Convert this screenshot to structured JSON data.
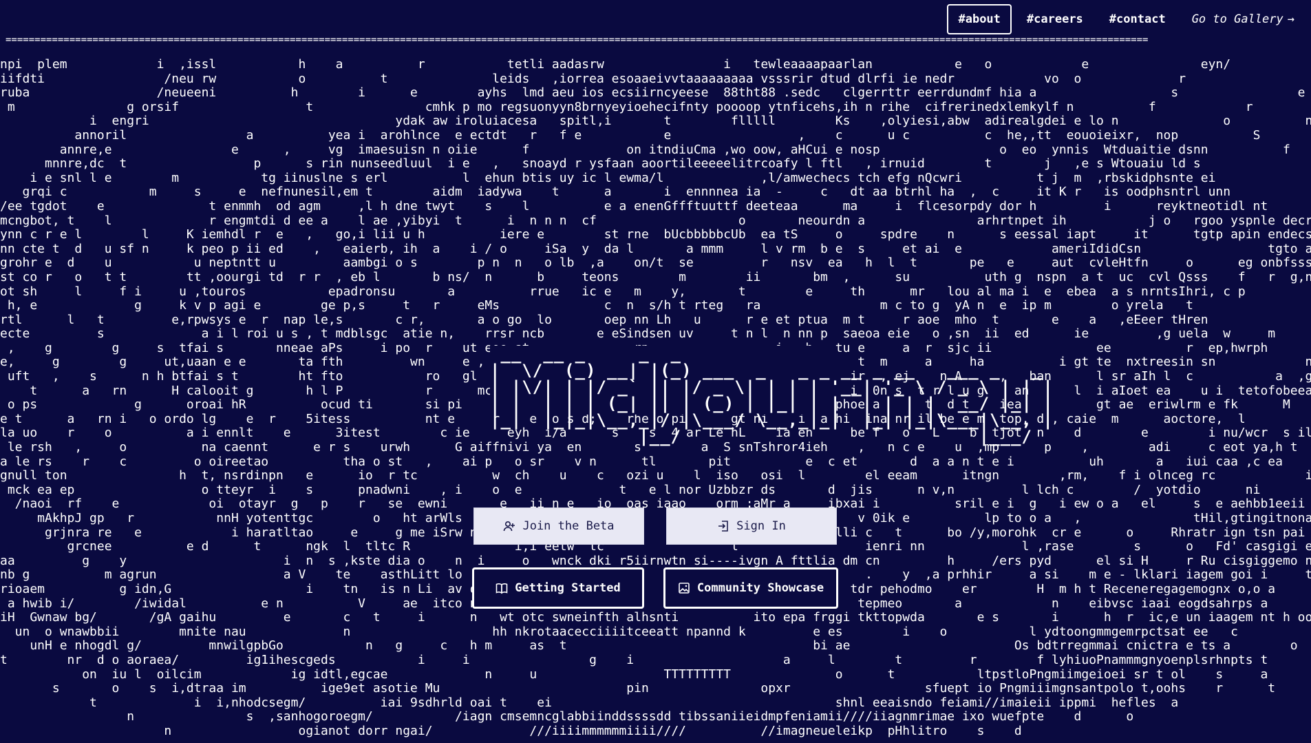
{
  "nav": {
    "about": "#about",
    "careers": "#careers",
    "contact": "#contact",
    "gallery": "Go to Gallery",
    "gallery_arrow": "→"
  },
  "divider": "=====================================================================================================================================================================================================",
  "logo_ascii": " __  __ _     _  _\n|  \\/  (_) __| |(_) ___  _   _ _ __ _ __   ___ _   _\n| |\\/| | |/ _` || |/ _ \\| | | | '__| '_ \\ / _ \\ | | |\n| |  | | | (_| || | (_) | |_| | |  | | | |  __/ |_| |\n|_|  |_|_|\\__,_|/ |\\___/ \\__,_|_|  |_| |_|\\___|\\__, |\n              |__/                            |___/",
  "logo_label": "Midjourney",
  "buttons": {
    "join_beta": "Join the Beta",
    "sign_in": "Sign In",
    "getting_started": "Getting Started",
    "community_showcase": "Community Showcase"
  },
  "background_lines": [
    "npi  plem            i  ,issl           h    a          r           tetli aadasrw                i   tewleaaaapaarlan           e   o            e               eyn/",
    "iifdti                /neu rw           o          t              leids   ,iorrea esoaaeivvtaaaaaaaaa vsssrir dtud dlrfi ie nedr            vo  o             r                    eta",
    "ruba                 /neueeni          h        i      e        ayhs  lmd aeu ios ecsiirncyeese  88tht88 .sedc   clgerrttr eerrdundmf hia a                  s                e",
    " m               g orsif                 t               cmhk p mo regsuonyyn8brnyeyioehecifnty poooop ytnficehs,ih n rihe  cifrerinedxlemkylf n          f            r",
    "            i  engri                                 ydak aw iroluiacesa   spitl,i       t        flllll        Ks    ,olyiesi,abw  adirealgdei e lo n              o          n",
    "          annoril                a          yea i  arohlnce  e ectdt   r   f e           e                 ,    c      u c          c  he,,tt  eouoieixr,  nop          S",
    "        annre,e                e      ,     vg  imaesuisn n oiie      f             on itndiuCma ,wo oow, aHCui e nosp                o  eo  ynnis  Wtduaitie dsnn          f          e l",
    "      mnnre,dc  t                 p      s rin nunseedluul  i e   ,   snoayd r ysfaan aoortileeeeelitrcoafy l ftl   , irnuid        t       j   ,e s Wtouaiu ld s",
    "    i e snl l e        m           tg iinuslne s erl          l  ehun btis uy ic l ewma/l             ,l/amwechecs tch efg nQcwri          t j  m  ,rbskidphsnte ei              a l",
    "   grqi c           m     s     e  nefnunesil,em t        aidm  iadywa    t      a       i  ennnnea ia  -     c   dt aa btrhl ha  ,  c     it K r   is oodphsntrl unn",
    "/ee tgdot    e              t enmmh  od agm     ,l h dne twyt    s    l          e a enenGffftuuttf deeteaa      ma     i  flcesorpdy dor h         i      reyktneotidl nt          o",
    "mcngbot, t    l             r engmtdi d ee a    l ae ,yibyi  t      i  n n n  cf                   o       neourdn a               arhrtnpet ih           j o   rgoo yspnle decrb       o",
    "ynn c r e l        l     K iemhdl r  e   ,   go,i lii u h          iere e        st rne  bUcbbbbbcUb  ea tS     o     spdre    n      s eessal iapt     it      tgtp apin endecst      S ,",
    "nn cte t  d   u sf n     k peo p ii ed    ,   eaierb, ih  a    i / o     iSa  y  da l       a mmm     l v rm  b e  s     et ai  e            ameriIdidCsn                 tgto asanly h ria",
    "grohr e  d    u           u neptntt u         aambgi o s        p n  n   o lb  ,a    on/t  se         r   nsv  ea   h  l  t       pe   e     aut  cvleHtfn     o      eg onbfsssrdabts      s",
    "st co r   o   t t        tt ,oourgi td  r r  , eb l       b ns/  n      b     teons        m        ii       bm  ,      su          uth g  nspn  a t  uc  cvl Qsss    f   r  g,nu a ailtph ito",
    "ot sh     l     f i     u ,touros           epadronsu       a          rrue   ic e   m    y,       t        e     th      mr   lou al ma i  e  ebea  a s nrntsIhri, c p              u,otp i yun npla",
    " h, e             g     k v p agi e        ge p,s     t   r     eMs              c  n  s/h t rteg   ra                m c to g  yA n  e  ip m        o yrela   t                 s n a  mcqodnnla",
    "rtl      l   t         e,rpwsys e  r  nap le,s       c r,       a o go  lo       oep nn Lh   u      r e et ptua  m t     r aoe  mho  t       e    a   ,eEeer tHren               i s ott   yun s tr",
    "ecte         s             a i l roi u s , t mdblsgc  atie n,    rrsr ncb       e eSindsen uv     t n l  n nn p  saeoa eie   o ,sn  ii  ed      ie         ,g uela  w     m       e     laeaiitpeo,rd",
    " ,    g        g     s  tfai s       nneae aPs     i po  r    ut eoe st              rp                 i   h   tu e     a  r  sjc ii              ee          r  ep,hwrph         r nalngi e  srgcrsl",
    "e,     g        g     ut,uaan e e       ta fth         wn     e ,    eo    o                                       t  m     a     ha          i gt te  nxtreesin sn            n dn lae  itsew,ro",
    " uft   ,    s      n h btfai s t        ht fto           ro   gl    ,/e                                           ir  , ej    n A     ,   ban      l sr aIh l  c           a  ,gnttee i onedin",
    "    t      a   rn      H calooit g       h l P           r      mc   n    b                                       i  0n s  t r l u g    an      l  i aIoet ea    u i  tetofobeeartp po y",
    " o ps             g      oroai hR          ocud ti       si pi     r e s5u  y    ri rrerd                 o n   phoe a      t  d t    iea          gt ae  eriwlrm e fk      M   ne o/ooeeartprpo y",
    "e t      a   rn i   o ordo lg    e  r    5itess          nt e     r    e  o s d;    rhe o pi      gt ni    i  a hi  ina nr il be e m  top, d , caie  m      aoctore,  l          ioe,iisne r   auc",
    "la uo    r    o          a i ennlt    e      3itest        c ie     eyh  i/a      s    s  4 ar Le hL    ia en     be f   o   L    b  tjot  n    d        e        i nu/wcr  s il      n  vtd hc5a neet i s",
    " le rsh   ,     o          na caennt      e r s    urwh      G aiffnivi ya  en       s        a  S snTshror4ieh    ,   n c e    u  ,mp      p    ,        adi     c eot ya,h t      t           ,g/conn r cefia",
    "a le rs    r    c         o oireetao          tha o st   ,    ai p   o sr    v n      tl       pit          e  c et       d  a a n t e i          uh       a   iui caa ,c ea       i  in'rr1eeiehts nen",
    "gnull ton               h  t, nsrdinpn   e      io  r tc          w  ch    u    c   ozi u    l  iso   osi  l        el eeam      itngn        ,rm,    f i olnceg rc            i  -a cn5r intnoaiJ i t",
    " mck ea ep                 o tteyr  i    s      pnadwni    , i    o  e             t   e l nor Uzbbzr ds       d  jis      n v,n         l lch c        /  yotdio      ni        n scn5r ii eb efie    ,",
    "  /naoi  rf    e            oi  otayr  g   p    r   se  ewni       e   ii n e   io  oas iaao    orm :aMr a     ibxai i          sril e i  g   i ew o a   el     s  e aehbb1eeii eb noor   u",
    "     mAkhpJ gp   r           nnH yotenttgc        o   ht arWls     a                                               v 0ik e          lp to o a   ,               tHil,gtingitnonaeie   u",
    "      grjnra re   e            i haratltao     e     g me iSrw n                                               flli c   t      bo /y,morohk  cr e      o     Rhratr ign tsn pai   ,",
    "         grcnee          e d      t      ngk  l  tltc R              i,i eetw  tc           '     l                 ienri nn             l ,rase        s      o   Fd' casgigi eoaomfoc   n     c",
    "aa         g    y                     i  n  s ,kste dia o    n  i     o   wnck dki r5iirnwtn si----ivgn A fttlia dm cn         h     /ers pyd      el si H     r Ru cisgiggemo nspel  u",
    "nb g          m agrun                 a V    te    asthLitt lo          t                                           .    y  ,a prhhir     a si    m e - lklari iagem goi i     t    t",
    "rioaem          g idn,G                  i    tn   is n Li  av o                                                  tdr pehodmo    er        H  m h t Receneregagemognx o,o a      y",
    " a hwib i/        /iwidal          e n          V     ae  itco nettno                                              tepmeo       a            n    eibvsc iaai eogdsahrps a",
    "iH  Gwnaw bg/       /gA gaihu         e       c   t     i      n   wt otc swneinfth alhsnti          ito epa frggi tkttopwda       e s       i      h  r  ic,e un iaagem nt h oo e a",
    "  un  o wnawbbii        mnite nau             n                   hh nkrotaacecciiiitceeatt npannd k         e es        i    o           l ydtoongmmgemrpctsat ee   c",
    "    unH e nhogdl g/         mnwilgpbGo           n   g     c   h m     as  t                                 bi ae                      Os bdtrregmmai cnictra e ts a        o              l",
    "t        nr  d o aoraea/         ig1ihescgeds           i     i                g    i                    a     l        t         r        f lyhiuoPnammmgnyoenplsrhnpts t      a",
    "           on  iu l  oilcim            ig idtl,egcae             n     u                 TTTTTTTTT              o      t           ltpstloPngmiimgeioei sr t ol    s     a",
    "       s       o    s  i,dtraa im          ige9et asotie Mu                         pin               opxr                  sfuept io Pngmiiimgnsantpolo t,oohs    r      t            l",
    "            t             i  i,nhodcsegm/          iai 9sdhrld oai t    ei                                      shnl eeaisndo feiami//imaieii ippmi  hefles  a",
    "                 n               s  ,sanhogoroegm/           /iagn cmsemncglabbiinddssssdd tibssaniieidmpfeniamii////iiagnmrimae ixo wuefpte    d      o",
    "                      n                 ogianot dorr ngai/             ///iiiimmmmmmiiii////          //imagneueleikp  pHhlitro    s    d"
  ]
}
